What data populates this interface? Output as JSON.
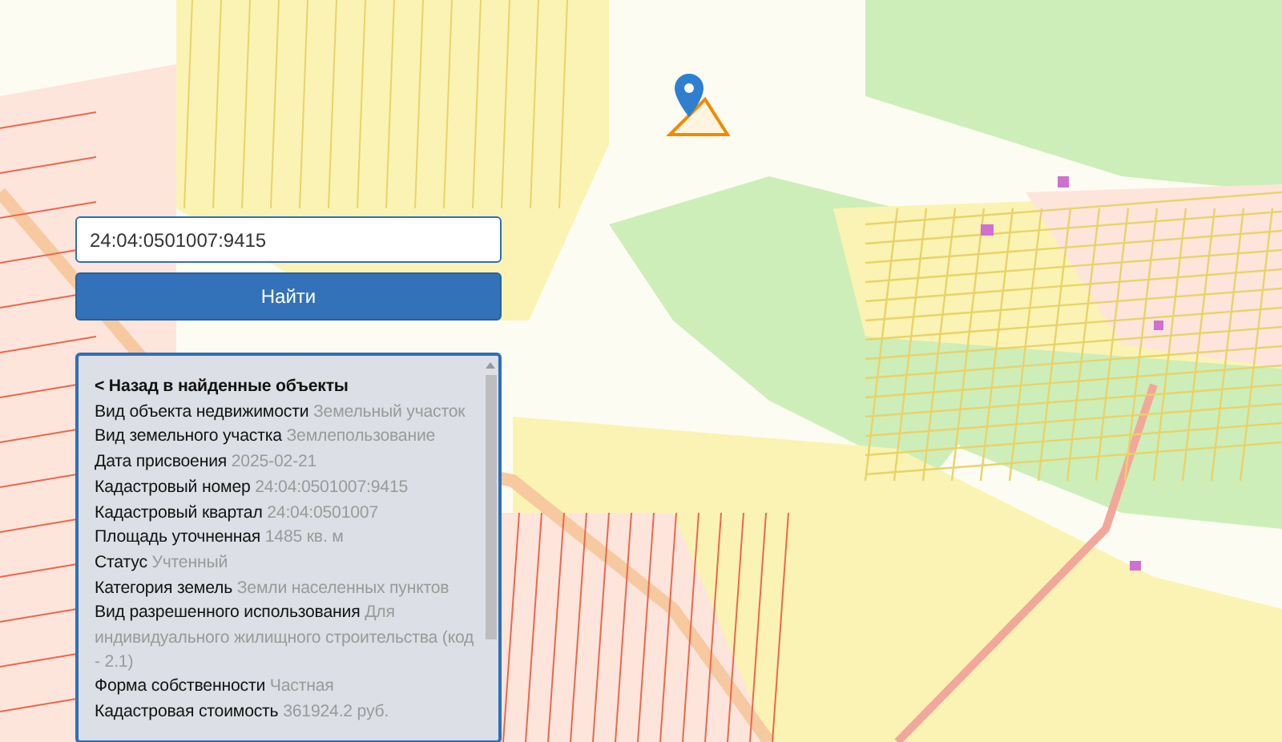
{
  "search": {
    "value": "24:04:0501007:9415"
  },
  "find_button": {
    "label": "Найти"
  },
  "details": {
    "back_link": "< Назад в найденные объекты",
    "fields": [
      {
        "label": "Вид объекта недвижимости",
        "value": "Земельный участок"
      },
      {
        "label": "Вид земельного участка",
        "value": "Землепользование"
      },
      {
        "label": "Дата присвоения",
        "value": "2025-02-21"
      },
      {
        "label": "Кадастровый номер",
        "value": "24:04:0501007:9415"
      },
      {
        "label": "Кадастровый квартал",
        "value": "24:04:0501007"
      },
      {
        "label": "Площадь уточненная",
        "value": "1485 кв. м"
      },
      {
        "label": "Статус",
        "value": "Учтенный"
      },
      {
        "label": "Категория земель",
        "value": "Земли населенных пунктов"
      },
      {
        "label": "Вид разрешенного использования",
        "value": "Для индивидуального жилищного строительства (код - 2.1)"
      },
      {
        "label": "Форма собственности",
        "value": "Частная"
      },
      {
        "label": "Кадастровая стоимость",
        "value": "361924.2 руб."
      }
    ]
  }
}
